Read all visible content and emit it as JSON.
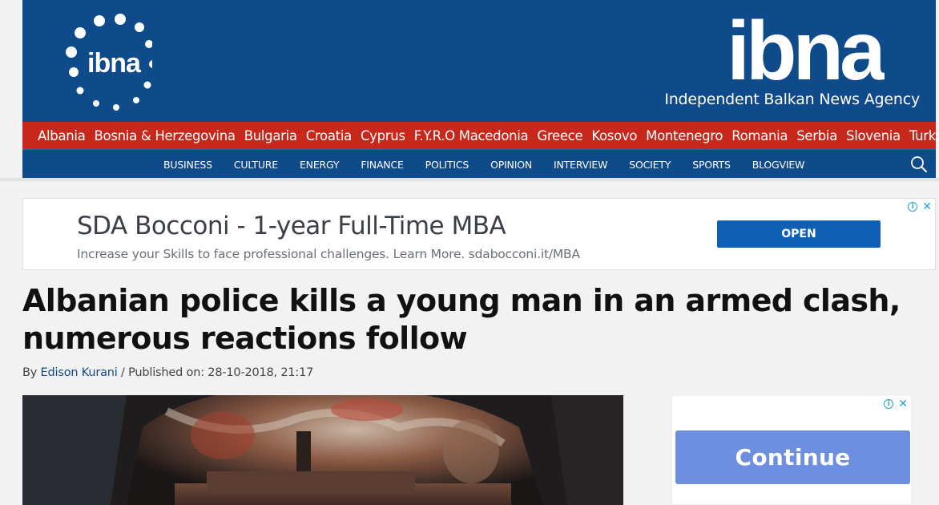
{
  "header": {
    "logo_small_text": "ibna",
    "logo_big_text": "ibna",
    "tagline": "Independent Balkan News Agency",
    "bg_color": "#0f4a8a"
  },
  "countries": [
    "Albania",
    "Bosnia & Herzegovina",
    "Bulgaria",
    "Croatia",
    "Cyprus",
    "F.Y.R.O Macedonia",
    "Greece",
    "Kosovo",
    "Montenegro",
    "Romania",
    "Serbia",
    "Slovenia",
    "Turkey"
  ],
  "sections": [
    "BUSINESS",
    "CULTURE",
    "ENERGY",
    "FINANCE",
    "POLITICS",
    "OPINION",
    "INTERVIEW",
    "SOCIETY",
    "SPORTS",
    "BLOGVIEW"
  ],
  "search": {
    "icon": "search-icon"
  },
  "ad_banner": {
    "title": "SDA Bocconi - 1-year Full-Time MBA",
    "description": "Increase your Skills to face professional challenges. Learn More. sdabocconi.it/MBA",
    "button_label": "OPEN",
    "info_glyph": "i",
    "close_glyph": "✕"
  },
  "article": {
    "title": "Albanian police kills a young man in an armed clash, numerous reactions follow",
    "byline_prefix": "By ",
    "author": "Edison Kurani",
    "published": " / Published on: 28-10-2018, 21:17"
  },
  "side_ad": {
    "button_label": "Continue",
    "info_glyph": "i",
    "close_glyph": "✕"
  },
  "colors": {
    "brand_blue": "#0f4a8a",
    "country_red": "#c8281c",
    "ad_button": "#0f5fb5",
    "continue_button": "#6c8fe0"
  }
}
